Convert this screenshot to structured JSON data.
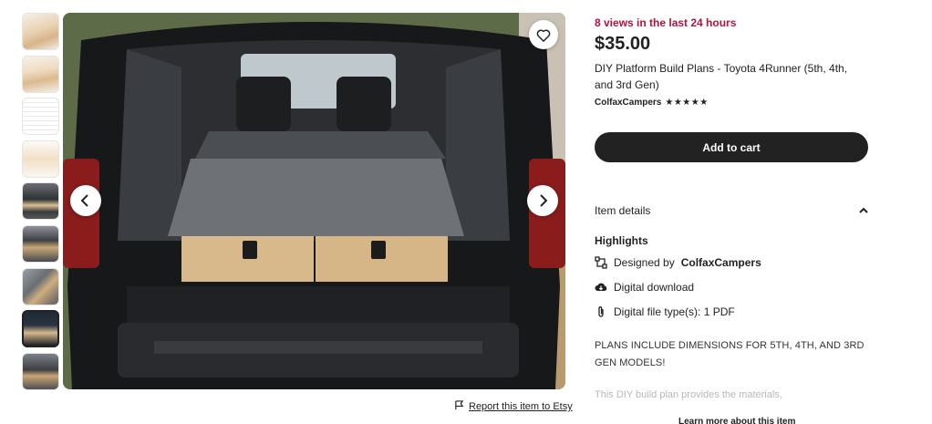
{
  "listing": {
    "views_notice": "8 views in the last 24 hours",
    "price": "$35.00",
    "title": "DIY Platform Build Plans - Toyota 4Runner (5th, 4th, and 3rd Gen)",
    "shop_name": "ColfaxCampers",
    "rating_stars": "★★★★★",
    "add_to_cart_label": "Add to cart"
  },
  "details": {
    "header_label": "Item details",
    "highlights_label": "Highlights",
    "designed_by_prefix": "Designed by",
    "designed_by_shop": "ColfaxCampers",
    "digital_download": "Digital download",
    "file_types": "Digital file type(s): 1 PDF",
    "description_line": "PLANS INCLUDE DIMENSIONS FOR 5TH, 4TH, AND 3RD GEN MODELS!",
    "description_faded": "This DIY build plan provides the materials,",
    "learn_more": "Learn more about this item"
  },
  "gallery": {
    "report_label": "Report this item to Etsy",
    "selected_index": 7,
    "thumbnail_count": 9
  },
  "colors": {
    "accent_red": "#b3133f",
    "button_dark": "#222222"
  },
  "icons": {
    "favorite": "heart-icon",
    "prev": "chevron-left-icon",
    "next": "chevron-right-icon",
    "report": "flag-icon",
    "collapse": "chevron-up-icon",
    "designed": "designer-icon",
    "download": "cloud-download-icon",
    "file": "paperclip-icon"
  }
}
